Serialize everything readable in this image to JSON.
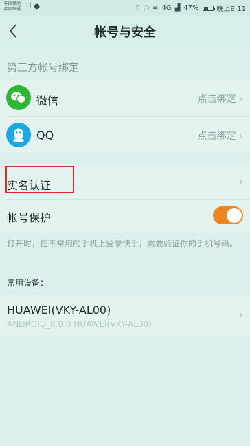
{
  "status_bar": {
    "carrier_line1": "中国移动",
    "carrier_line2": "中国联通",
    "signal_text": "4G",
    "battery": "47%",
    "time": "晚上8:11",
    "battery_level": 0.47
  },
  "header": {
    "title": "帐号与安全",
    "back_icon": "chevron-left-icon"
  },
  "third_party": {
    "section_title": "第三方帐号绑定",
    "items": [
      {
        "icon": "wechat-icon",
        "label": "微信",
        "action": "点击绑定"
      },
      {
        "icon": "qq-icon",
        "label": "QQ",
        "action": "点击绑定"
      }
    ]
  },
  "verification": {
    "label": "实名认证"
  },
  "protection": {
    "label": "帐号保护",
    "enabled": true,
    "note": "打开时，在不常用的手机上登录快手，需要验证你的手机号码。"
  },
  "devices": {
    "title": "常用设备：",
    "items": [
      {
        "name": "HUAWEI(VKY-AL00)",
        "detail": "ANDROID_8.0.0 HUAWEI(VKY-AL00)"
      }
    ]
  },
  "colors": {
    "background": "#dcefec",
    "toggle_on": "#f08520",
    "highlight": "#d92b2b",
    "wechat": "#2ab832",
    "qq": "#1aa9e8"
  }
}
